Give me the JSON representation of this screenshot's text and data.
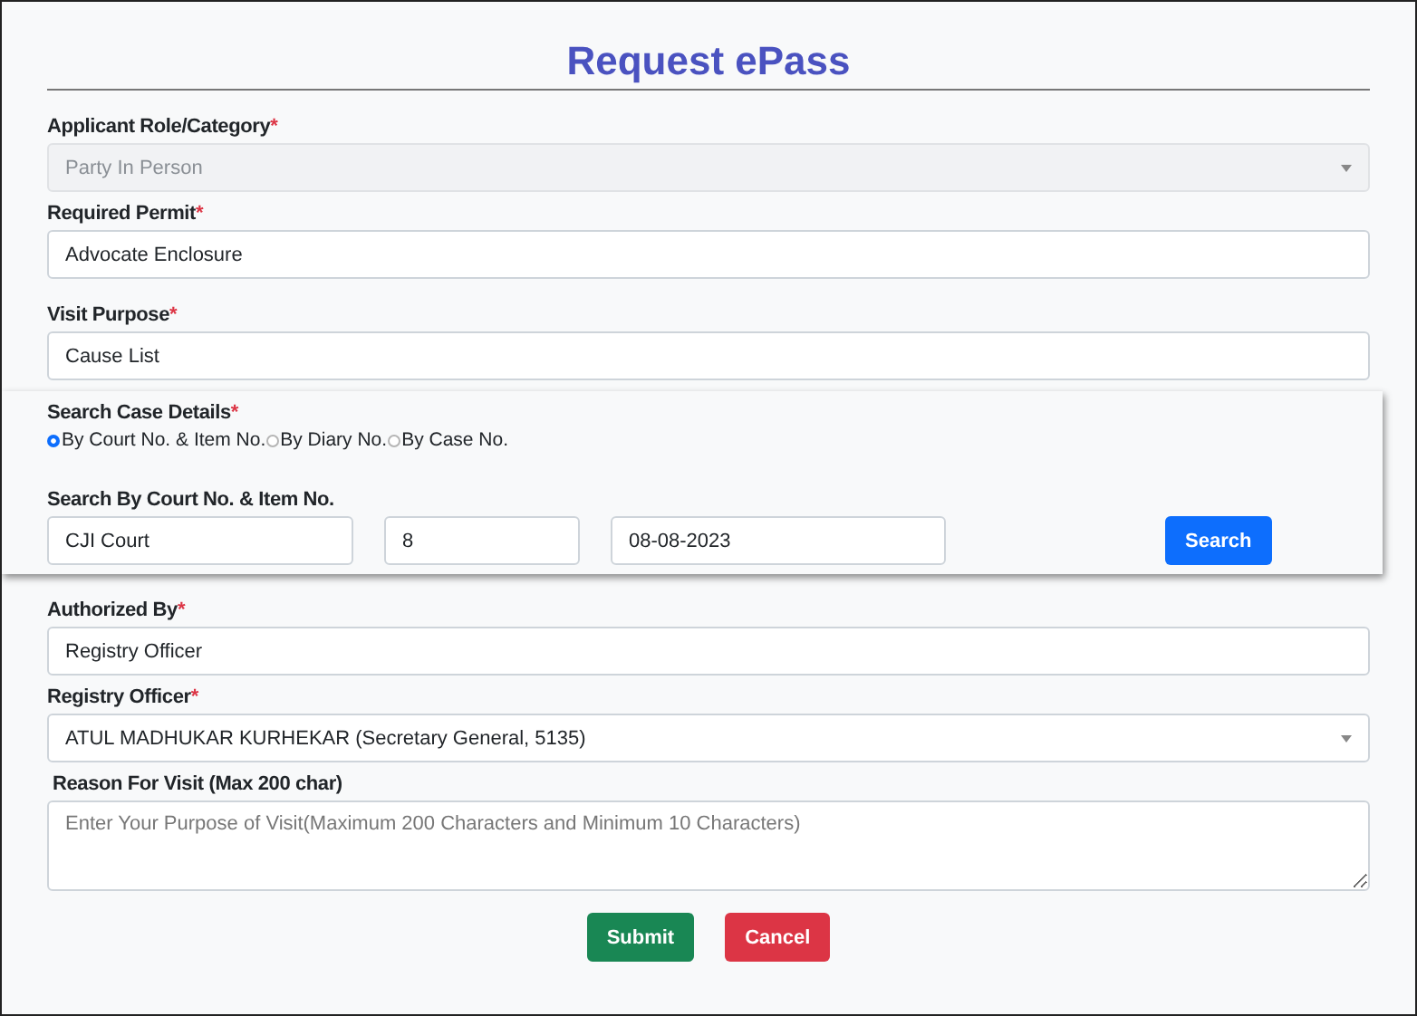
{
  "title": "Request ePass",
  "fields_top": [
    {
      "kind": "select",
      "label": "Applicant Role/Category",
      "required_mark": "*",
      "value": "Party In Person",
      "disabled": true
    },
    {
      "kind": "input",
      "label": "Required Permit",
      "required_mark": "*",
      "value": "Advocate Enclosure",
      "disabled": false
    },
    {
      "kind": "input",
      "label": "Visit Purpose",
      "required_mark": "*",
      "value": "Cause List",
      "disabled": false
    }
  ],
  "case_search": {
    "label": "Search Case Details",
    "required_mark": "*",
    "options": [
      {
        "label": "By Court No. & Item No.",
        "selected": true
      },
      {
        "label": "By Diary No.",
        "selected": false
      },
      {
        "label": "By Case No.",
        "selected": false
      }
    ],
    "sub_label": "Search By Court No. & Item No.",
    "inputs": [
      "CJI Court",
      "8",
      "08-08-2023"
    ],
    "button": "Search"
  },
  "fields_bottom": [
    {
      "kind": "input",
      "label": "Authorized By",
      "required_mark": "*",
      "value": "Registry Officer",
      "disabled": false
    },
    {
      "kind": "select",
      "label": "Registry Officer",
      "required_mark": "*",
      "value": "ATUL MADHUKAR KURHEKAR (Secretary General, 5135)",
      "disabled": false
    },
    {
      "kind": "textarea",
      "label": "Reason For Visit (Max 200 char)",
      "placeholder": "Enter Your Purpose of Visit(Maximum 200 Characters and Minimum 10 Characters)"
    }
  ],
  "buttons": [
    {
      "label": "Submit",
      "kind": "primary"
    },
    {
      "label": "Cancel",
      "kind": "danger"
    }
  ]
}
